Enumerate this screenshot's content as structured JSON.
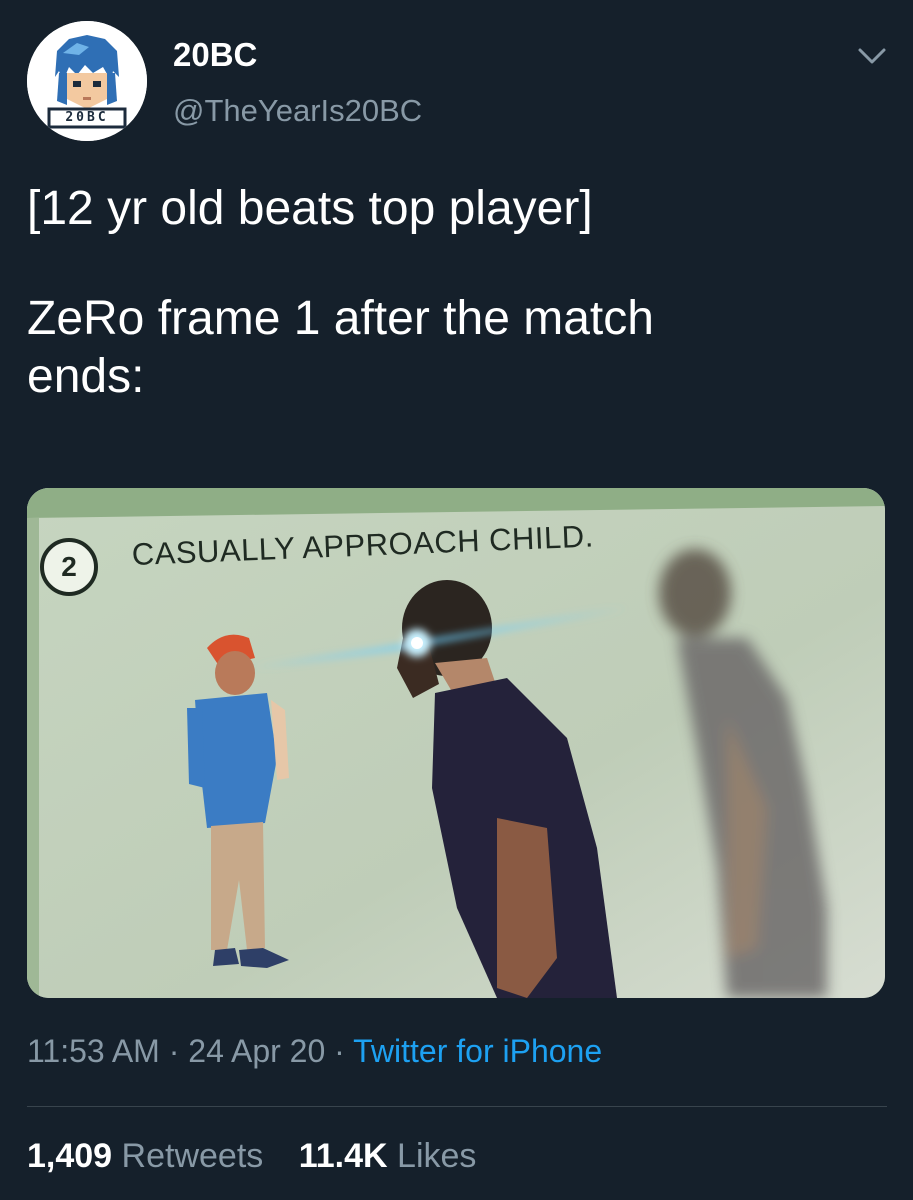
{
  "tweet": {
    "author": {
      "display_name": "20BC",
      "handle": "@TheYearIs20BC",
      "avatar_label": "20BC"
    },
    "text_lines": {
      "line1": "[12 yr old beats top player]",
      "line2": "ZeRo frame 1 after the match",
      "line3": "ends:"
    },
    "media": {
      "step_number": "2",
      "caption": "CASUALLY APPROACH CHILD."
    },
    "meta": {
      "time": "11:53 AM",
      "separator": " · ",
      "date": "24 Apr 20",
      "source": "Twitter for iPhone"
    },
    "stats": {
      "retweets_count": "1,409",
      "retweets_label": "Retweets",
      "likes_count": "11.4K",
      "likes_label": "Likes"
    },
    "icons": {
      "menu": "chevron-down-icon"
    },
    "colors": {
      "background": "#15202b",
      "secondary_text": "#8899a6",
      "link": "#1da1f2",
      "divider": "#38444d"
    }
  }
}
